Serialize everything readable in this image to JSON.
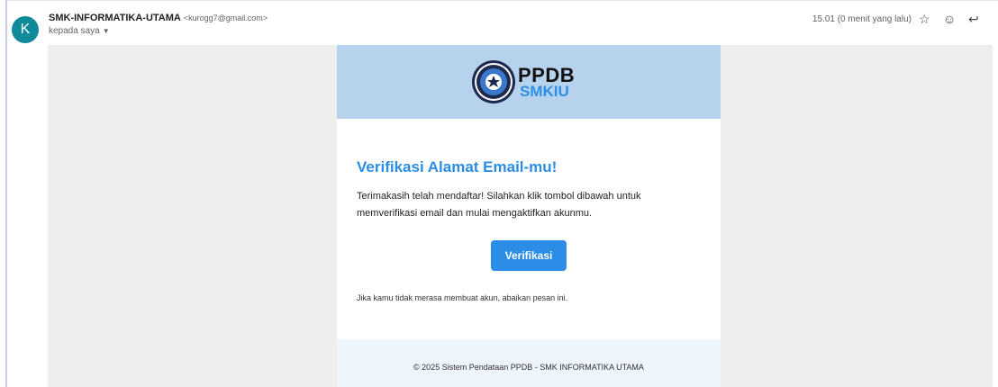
{
  "header": {
    "avatar_letter": "K",
    "sender_name": "SMK-INFORMATIKA-UTAMA",
    "sender_email": "<kurogg7@gmail.com>",
    "recipient": "kepada saya",
    "timestamp": "15.01 (0 menit yang lalu)",
    "icons": [
      "star-icon",
      "emoji-icon",
      "reply-icon"
    ]
  },
  "email": {
    "logo_top": "PPDB",
    "logo_bottom": "SMKIU",
    "title": "Verifikasi Alamat Email-mu!",
    "description": "Terimakasih telah mendaftar! Silahkan klik tombol dibawah untuk memverifikasi email dan mulai mengaktifkan akunmu.",
    "button_label": "Verifikasi",
    "note": "Jika kamu tidak merasa membuat akun, abaikan pesan ini.",
    "footer": "© 2025 Sistem Pendataan PPDB - SMK INFORMATIKA UTAMA"
  },
  "colors": {
    "accent": "#2b8de6",
    "banner": "#b7d2ec",
    "avatar": "#0f8a9b"
  }
}
